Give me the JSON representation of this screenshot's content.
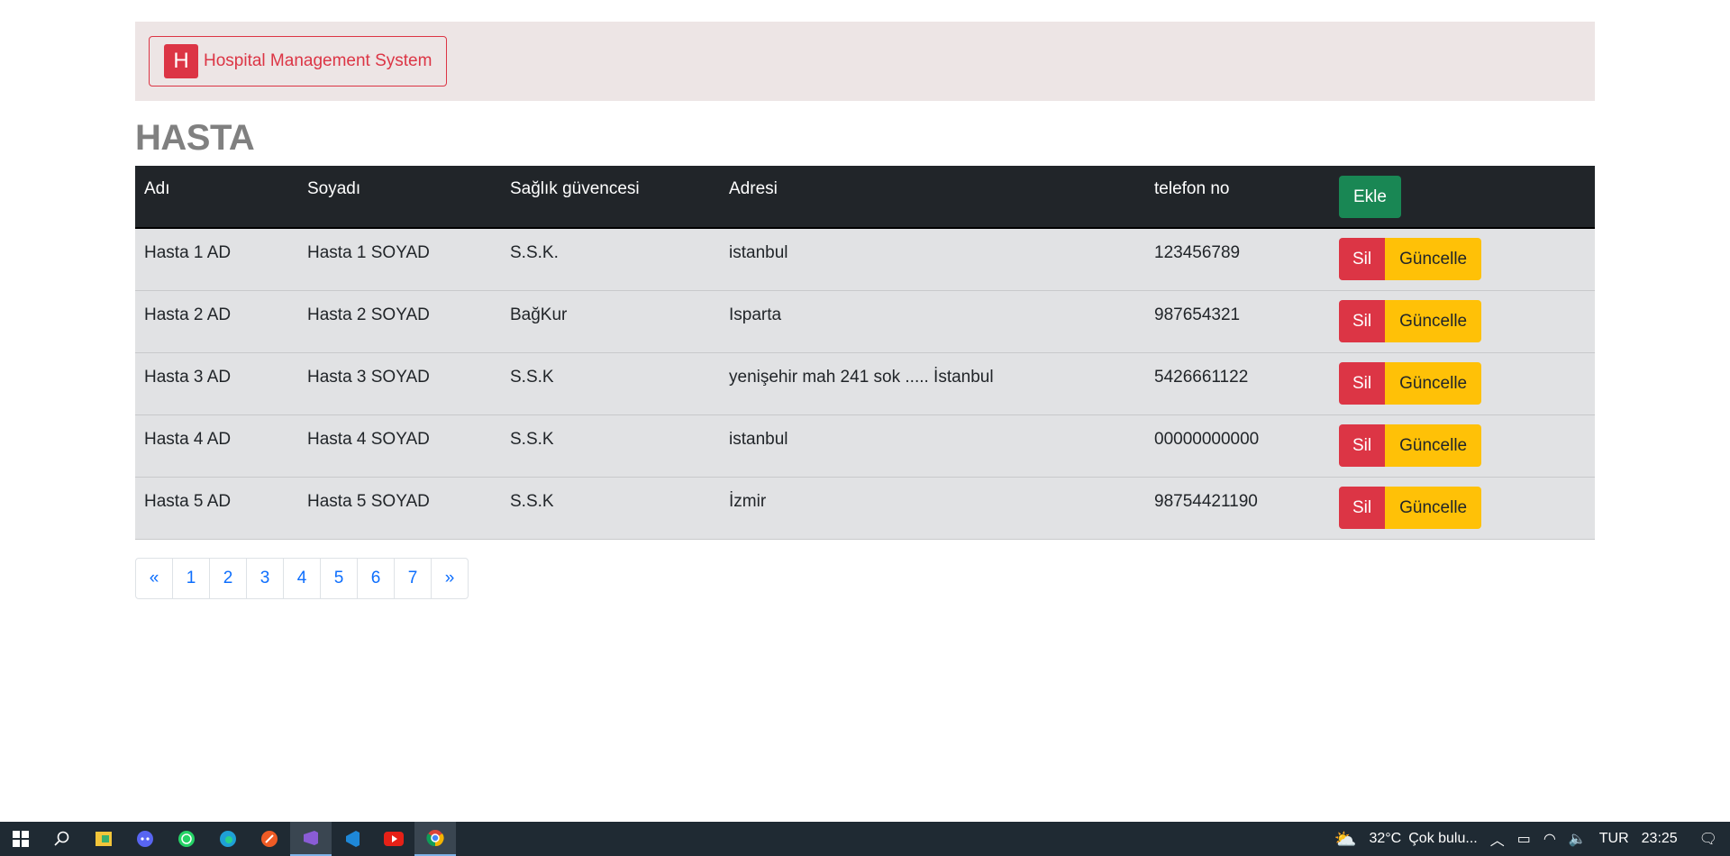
{
  "navbar": {
    "logo_letter": "H",
    "brand": "Hospital Management System"
  },
  "page_title": "HASTA",
  "table": {
    "headers": [
      "Adı",
      "Soyadı",
      "Sağlık güvencesi",
      "Adresi",
      "telefon no"
    ],
    "add_label": "Ekle",
    "delete_label": "Sil",
    "update_label": "Güncelle",
    "rows": [
      [
        "Hasta 1 AD",
        "Hasta 1 SOYAD",
        "S.S.K.",
        "istanbul",
        "123456789"
      ],
      [
        "Hasta 2 AD",
        "Hasta 2 SOYAD",
        "BağKur",
        "Isparta",
        "987654321"
      ],
      [
        "Hasta 3 AD",
        "Hasta 3 SOYAD",
        "S.S.K",
        "yenişehir mah 241 sok ..... İstanbul",
        "5426661122"
      ],
      [
        "Hasta 4 AD",
        "Hasta 4 SOYAD",
        "S.S.K",
        "istanbul",
        "00000000000"
      ],
      [
        "Hasta 5 AD",
        "Hasta 5 SOYAD",
        "S.S.K",
        "İzmir",
        "98754421190"
      ]
    ]
  },
  "pagination": [
    "«",
    "1",
    "2",
    "3",
    "4",
    "5",
    "6",
    "7",
    "»"
  ],
  "taskbar": {
    "weather_temp": "32°C",
    "weather_text": "Çok bulu...",
    "language": "TUR",
    "time": "23:25",
    "apps": [
      "start-icon",
      "search-icon",
      "files-icon",
      "discord-icon",
      "whatsapp-icon",
      "edge-icon",
      "postman-icon",
      "visual-studio-icon",
      "vscode-icon",
      "youtube-icon",
      "chrome-icon"
    ]
  },
  "colors": {
    "danger": "#dc3545",
    "success": "#198754",
    "warning": "#ffc107",
    "dark": "#212529"
  }
}
